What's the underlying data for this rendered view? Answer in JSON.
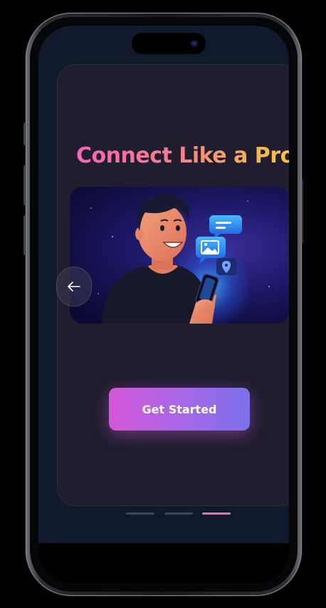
{
  "onboarding": {
    "title": "Connect Like a Pro",
    "cta_label": "Get Started",
    "back_icon": "arrow-left-icon",
    "pagination": {
      "total": 3,
      "active_index": 2
    }
  },
  "colors": {
    "screen_background": "#111a2c",
    "card_background": "#1f1d2e",
    "title_gradient": [
      "#f565b5",
      "#f6a860",
      "#f8c43e"
    ],
    "cta_gradient": [
      "#d458d8",
      "#7b72ec"
    ],
    "dot_inactive": "#3d4656",
    "dot_active": "#ee6fb1"
  },
  "illustration": {
    "subject": "person-with-smartphone-messaging-illustration",
    "icons": [
      "chat-bubble-icon",
      "image-message-icon",
      "location-pin-icon"
    ]
  }
}
